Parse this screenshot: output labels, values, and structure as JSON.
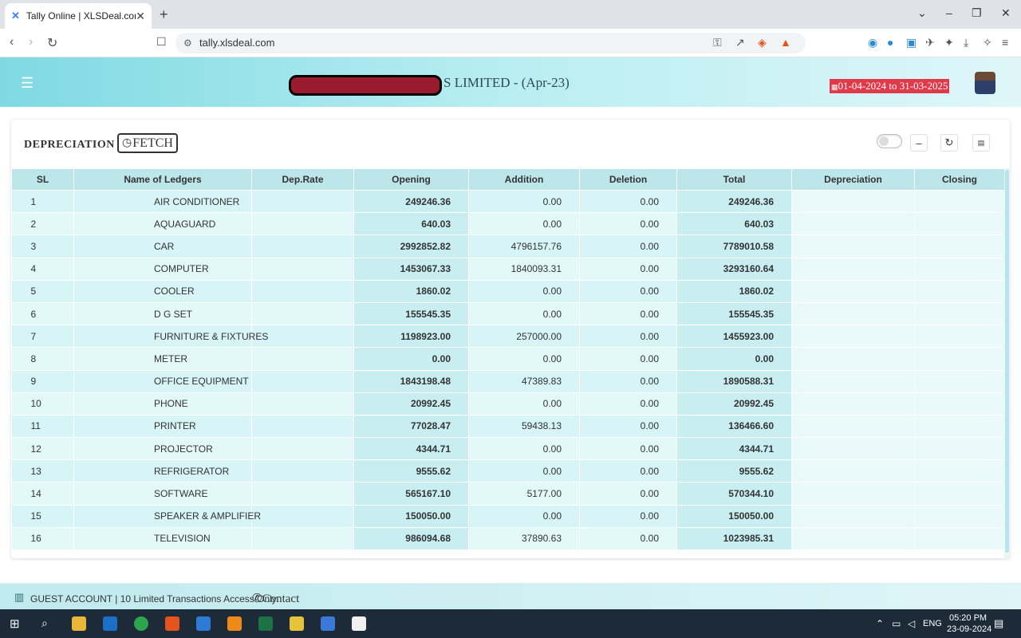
{
  "browser": {
    "tab_title": "Tally Online | XLSDeal.com",
    "url": "tally.xlsdeal.com"
  },
  "header": {
    "company_suffix": "S LIMITED - (Apr-23)",
    "period": "01-04-2024 to 31-03-2025"
  },
  "card": {
    "title": "DEPRECIATION :",
    "fetch_label": "FETCH"
  },
  "table": {
    "columns": [
      "SL",
      "Name of Ledgers",
      "Dep.Rate",
      "Opening",
      "Addition",
      "Deletion",
      "Total",
      "Depreciation",
      "Closing"
    ],
    "rows": [
      {
        "sl": "1",
        "name": "AIR CONDITIONER",
        "rate": "",
        "opening": "249246.36",
        "addition": "0.00",
        "deletion": "0.00",
        "total": "249246.36",
        "depreciation": "",
        "closing": ""
      },
      {
        "sl": "2",
        "name": "AQUAGUARD",
        "rate": "",
        "opening": "640.03",
        "addition": "0.00",
        "deletion": "0.00",
        "total": "640.03",
        "depreciation": "",
        "closing": ""
      },
      {
        "sl": "3",
        "name": "CAR",
        "rate": "",
        "opening": "2992852.82",
        "addition": "4796157.76",
        "deletion": "0.00",
        "total": "7789010.58",
        "depreciation": "",
        "closing": ""
      },
      {
        "sl": "4",
        "name": "COMPUTER",
        "rate": "",
        "opening": "1453067.33",
        "addition": "1840093.31",
        "deletion": "0.00",
        "total": "3293160.64",
        "depreciation": "",
        "closing": ""
      },
      {
        "sl": "5",
        "name": "COOLER",
        "rate": "",
        "opening": "1860.02",
        "addition": "0.00",
        "deletion": "0.00",
        "total": "1860.02",
        "depreciation": "",
        "closing": ""
      },
      {
        "sl": "6",
        "name": "D G SET",
        "rate": "",
        "opening": "155545.35",
        "addition": "0.00",
        "deletion": "0.00",
        "total": "155545.35",
        "depreciation": "",
        "closing": ""
      },
      {
        "sl": "7",
        "name": "FURNITURE & FIXTURES",
        "rate": "",
        "opening": "1198923.00",
        "addition": "257000.00",
        "deletion": "0.00",
        "total": "1455923.00",
        "depreciation": "",
        "closing": ""
      },
      {
        "sl": "8",
        "name": "METER",
        "rate": "",
        "opening": "0.00",
        "addition": "0.00",
        "deletion": "0.00",
        "total": "0.00",
        "depreciation": "",
        "closing": ""
      },
      {
        "sl": "9",
        "name": "OFFICE EQUIPMENT",
        "rate": "",
        "opening": "1843198.48",
        "addition": "47389.83",
        "deletion": "0.00",
        "total": "1890588.31",
        "depreciation": "",
        "closing": ""
      },
      {
        "sl": "10",
        "name": "PHONE",
        "rate": "",
        "opening": "20992.45",
        "addition": "0.00",
        "deletion": "0.00",
        "total": "20992.45",
        "depreciation": "",
        "closing": ""
      },
      {
        "sl": "11",
        "name": "PRINTER",
        "rate": "",
        "opening": "77028.47",
        "addition": "59438.13",
        "deletion": "0.00",
        "total": "136466.60",
        "depreciation": "",
        "closing": ""
      },
      {
        "sl": "12",
        "name": "PROJECTOR",
        "rate": "",
        "opening": "4344.71",
        "addition": "0.00",
        "deletion": "0.00",
        "total": "4344.71",
        "depreciation": "",
        "closing": ""
      },
      {
        "sl": "13",
        "name": "REFRIGERATOR",
        "rate": "",
        "opening": "9555.62",
        "addition": "0.00",
        "deletion": "0.00",
        "total": "9555.62",
        "depreciation": "",
        "closing": ""
      },
      {
        "sl": "14",
        "name": "SOFTWARE",
        "rate": "",
        "opening": "565167.10",
        "addition": "5177.00",
        "deletion": "0.00",
        "total": "570344.10",
        "depreciation": "",
        "closing": ""
      },
      {
        "sl": "15",
        "name": "SPEAKER & AMPLIFIER",
        "rate": "",
        "opening": "150050.00",
        "addition": "0.00",
        "deletion": "0.00",
        "total": "150050.00",
        "depreciation": "",
        "closing": ""
      },
      {
        "sl": "16",
        "name": "TELEVISION",
        "rate": "",
        "opening": "986094.68",
        "addition": "37890.63",
        "deletion": "0.00",
        "total": "1023985.31",
        "depreciation": "",
        "closing": ""
      }
    ]
  },
  "footer": {
    "guest_text": "GUEST ACCOUNT | 10 Limited Transactions Access Only.",
    "contact_label": "Contact"
  },
  "taskbar": {
    "lang": "ENG",
    "time": "05:20 PM",
    "date": "23-09-2024"
  },
  "colors": {
    "header_accent": "#7fd9e3",
    "table_header": "#bde6ea",
    "period_badge": "#e03a4a"
  }
}
